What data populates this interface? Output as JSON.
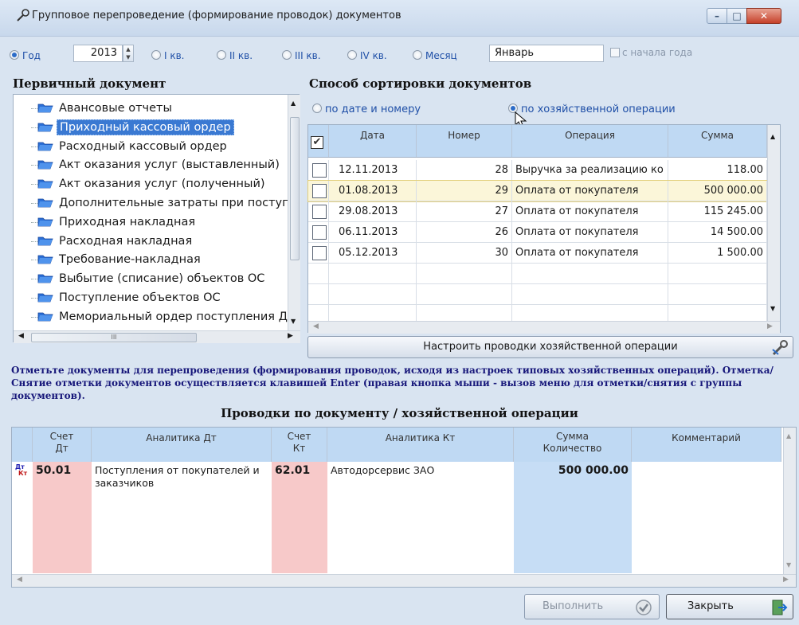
{
  "window": {
    "title": "Групповое перепроведение (формирование проводок) документов",
    "min": "–",
    "max": "□",
    "close": "✕"
  },
  "period": {
    "year_label": "Год",
    "year_value": "2013",
    "q1": "I кв.",
    "q2": "II кв.",
    "q3": "III кв.",
    "q4": "IV кв.",
    "month_label": "Месяц",
    "month_value": "Январь",
    "from_year_start": "с начала года"
  },
  "primary_doc": {
    "heading": "Первичный документ",
    "items": [
      "Авансовые отчеты",
      "Приходный кассовый ордер",
      "Расходный кассовый ордер",
      "Акт оказания услуг (выставленный)",
      "Акт оказания услуг (полученный)",
      "Дополнительные затраты при поступ",
      "Приходная накладная",
      "Расходная накладная",
      "Требование-накладная",
      "Выбытие (списание) объектов ОС",
      "Поступление объектов ОС",
      "Мемориальный ордер поступления Д"
    ],
    "selected_index": 1,
    "hscroll_mark": "III"
  },
  "sort": {
    "heading": "Способ сортировки документов",
    "by_date": "по дате и номеру",
    "by_operation": "по хозяйственной операции",
    "selected": "by_operation"
  },
  "docs_grid": {
    "columns": [
      "Дата",
      "Номер",
      "Операция",
      "Сумма"
    ],
    "rows": [
      {
        "date": "12.11.2013",
        "num": "28",
        "op": "Выручка за реализацию ко",
        "sum": "118.00"
      },
      {
        "date": "01.08.2013",
        "num": "29",
        "op": "Оплата от покупателя",
        "sum": "500 000.00"
      },
      {
        "date": "29.08.2013",
        "num": "27",
        "op": "Оплата от покупателя",
        "sum": "115 245.00"
      },
      {
        "date": "06.11.2013",
        "num": "26",
        "op": "Оплата от покупателя",
        "sum": "14 500.00"
      },
      {
        "date": "05.12.2013",
        "num": "30",
        "op": "Оплата от покупателя",
        "sum": "1 500.00"
      }
    ],
    "header_checked": true,
    "selected_row": 1
  },
  "setup_button": "Настроить проводки хозяйственной операции",
  "note": "Отметьте документы для перепроведения (формирования проводок, исходя из настроек типовых хозяйственных операций). Отметка/Снятие отметки документов осуществляется клавишей Enter (правая кнопка мыши - вызов меню для отметки/снятия с группы документов).",
  "postings": {
    "heading": "Проводки по документу / хозяйственной операции",
    "col_dt_1": "Счет",
    "col_dt_2": "Дт",
    "col_an_dt": "Аналитика Дт",
    "col_kt_1": "Счет",
    "col_kt_2": "Кт",
    "col_an_kt": "Аналитика Кт",
    "col_sum_1": "Сумма",
    "col_sum_2": "Количество",
    "col_comment": "Комментарий",
    "row": {
      "marker_dt": "Дт",
      "marker_kt": "Кт",
      "dt": "50.01",
      "an_dt": "Поступления от покупателей и заказчиков",
      "kt": "62.01",
      "an_kt": "Автодорсервис ЗАО",
      "sum": "500 000.00",
      "comment": ""
    }
  },
  "buttons": {
    "run": "Выполнить",
    "close": "Закрыть"
  },
  "colors": {
    "selection": "#3a79d2",
    "header_bg": "#bfd9f3",
    "pink_col": "#f7c9c9",
    "blue_col": "#c6ddf5",
    "note_text": "#17177a"
  }
}
